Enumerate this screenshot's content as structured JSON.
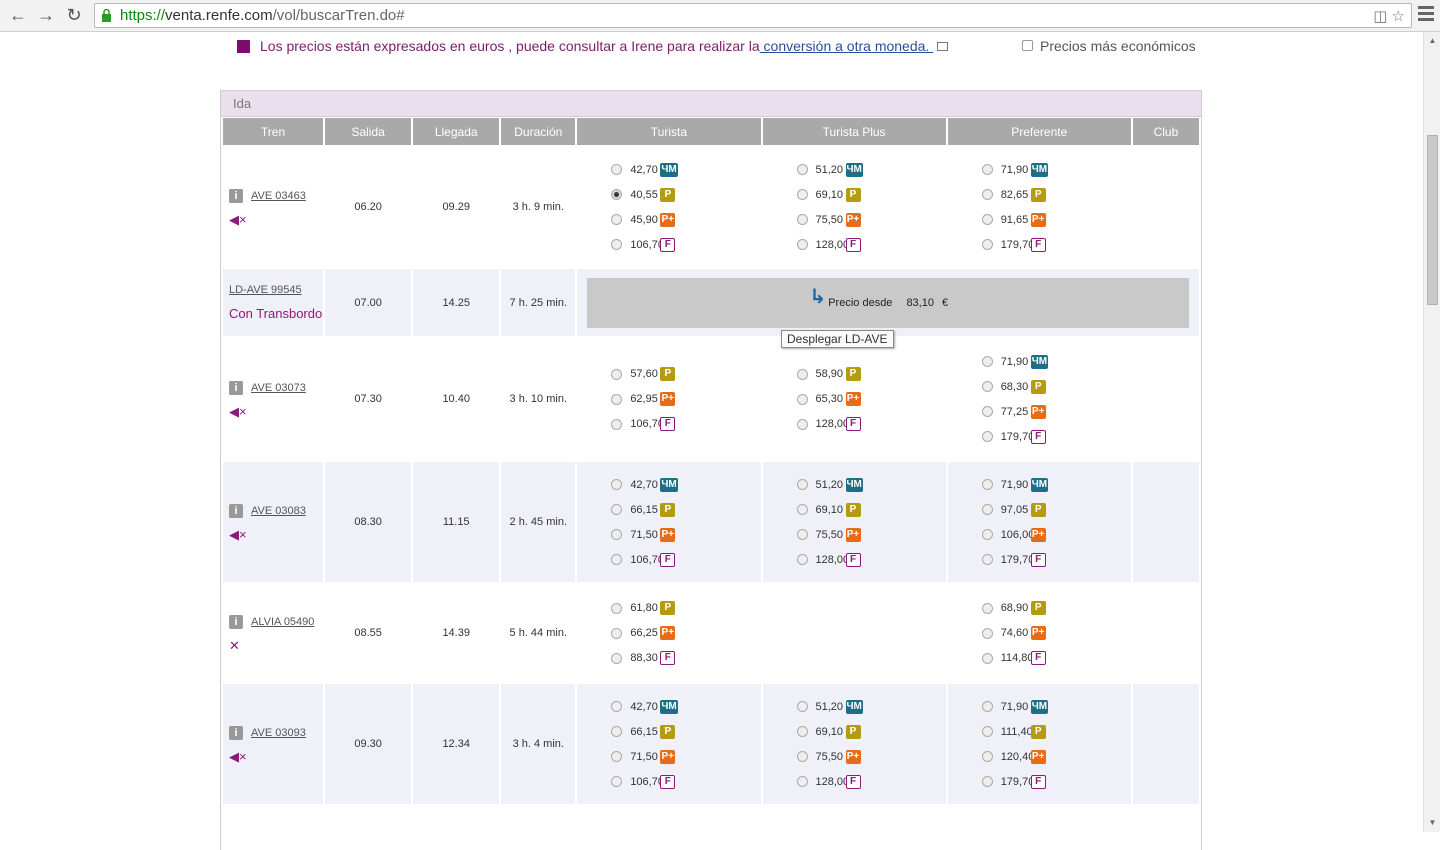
{
  "browser": {
    "url_proto": "https://",
    "url_host": "venta.renfe.com",
    "url_path": "/vol/buscarTren.do#"
  },
  "notice": {
    "text": "Los precios están expresados en euros , puede consultar a Irene para realizar la",
    "link": " conversión a otra moneda. ",
    "cheapest_label": "Precios más económicos"
  },
  "section_title": "Ida",
  "columns": [
    "Tren",
    "Salida",
    "Llegada",
    "Duración",
    "Turista",
    "Turista Plus",
    "Preferente",
    "Club"
  ],
  "tooltip": "Desplegar LD-AVE",
  "colors": {
    "accent": "#8b1a7b",
    "header": "#a9a9a9",
    "jm": "#1e6f85",
    "p": "#b49b12",
    "pplus": "#e66c1a"
  },
  "trains": [
    {
      "name": "AVE 03463",
      "salida": "06.20",
      "llegada": "09.29",
      "duracion": "3 h. 9 min.",
      "icon": "mute-icon",
      "turista": [
        [
          "42,70",
          "ЧМ"
        ],
        [
          "40,55",
          "P"
        ],
        [
          "45,90",
          "P+"
        ],
        [
          "106,70",
          "F"
        ]
      ],
      "turista_plus": [
        [
          "51,20",
          "ЧМ"
        ],
        [
          "69,10",
          "P"
        ],
        [
          "75,50",
          "P+"
        ],
        [
          "128,00",
          "F"
        ]
      ],
      "preferente": [
        [
          "71,90",
          "ЧМ"
        ],
        [
          "82,65",
          "P"
        ],
        [
          "91,65",
          "P+"
        ],
        [
          "179,70",
          "F"
        ]
      ]
    },
    {
      "name": "LD-AVE 99545",
      "salida": "07.00",
      "llegada": "14.25",
      "duracion": "7 h. 25 min.",
      "transbordo": "Con Transbordo",
      "desde_label": "Precio desde",
      "desde_price": "83,10",
      "currency": "€"
    },
    {
      "name": "AVE 03073",
      "salida": "07.30",
      "llegada": "10.40",
      "duracion": "3 h. 10 min.",
      "icon": "mute-icon",
      "turista": [
        [
          "57,60",
          "P"
        ],
        [
          "62,95",
          "P+"
        ],
        [
          "106,70",
          "F"
        ]
      ],
      "turista_plus": [
        [
          "58,90",
          "P"
        ],
        [
          "65,30",
          "P+"
        ],
        [
          "128,00",
          "F"
        ]
      ],
      "preferente": [
        [
          "71,90",
          "ЧМ"
        ],
        [
          "68,30",
          "P"
        ],
        [
          "77,25",
          "P+"
        ],
        [
          "179,70",
          "F"
        ]
      ]
    },
    {
      "name": "AVE 03083",
      "salida": "08.30",
      "llegada": "11.15",
      "duracion": "2 h. 45 min.",
      "icon": "mute-icon",
      "turista": [
        [
          "42,70",
          "ЧМ"
        ],
        [
          "66,15",
          "P"
        ],
        [
          "71,50",
          "P+"
        ],
        [
          "106,70",
          "F"
        ]
      ],
      "turista_plus": [
        [
          "51,20",
          "ЧМ"
        ],
        [
          "69,10",
          "P"
        ],
        [
          "75,50",
          "P+"
        ],
        [
          "128,00",
          "F"
        ]
      ],
      "preferente": [
        [
          "71,90",
          "ЧМ"
        ],
        [
          "97,05",
          "P"
        ],
        [
          "106,00",
          "P+"
        ],
        [
          "179,70",
          "F"
        ]
      ]
    },
    {
      "name": "ALVIA 05490",
      "salida": "08.55",
      "llegada": "14.39",
      "duracion": "5 h. 44 min.",
      "icon": "restaurant-icon",
      "turista": [
        [
          "61,80",
          "P"
        ],
        [
          "66,25",
          "P+"
        ],
        [
          "88,30",
          "F"
        ]
      ],
      "turista_plus": [],
      "preferente": [
        [
          "68,90",
          "P"
        ],
        [
          "74,60",
          "P+"
        ],
        [
          "114,80",
          "F"
        ]
      ]
    },
    {
      "name": "AVE 03093",
      "salida": "09.30",
      "llegada": "12.34",
      "duracion": "3 h. 4 min.",
      "icon": "mute-icon",
      "turista": [
        [
          "42,70",
          "ЧМ"
        ],
        [
          "66,15",
          "P"
        ],
        [
          "71,50",
          "P+"
        ],
        [
          "106,70",
          "F"
        ]
      ],
      "turista_plus": [
        [
          "51,20",
          "ЧМ"
        ],
        [
          "69,10",
          "P"
        ],
        [
          "75,50",
          "P+"
        ],
        [
          "128,00",
          "F"
        ]
      ],
      "preferente": [
        [
          "71,90",
          "ЧМ"
        ],
        [
          "111,40",
          "P"
        ],
        [
          "120,40",
          "P+"
        ],
        [
          "179,70",
          "F"
        ]
      ]
    }
  ],
  "selected": {
    "row": 0,
    "class": "turista",
    "index": 1
  }
}
